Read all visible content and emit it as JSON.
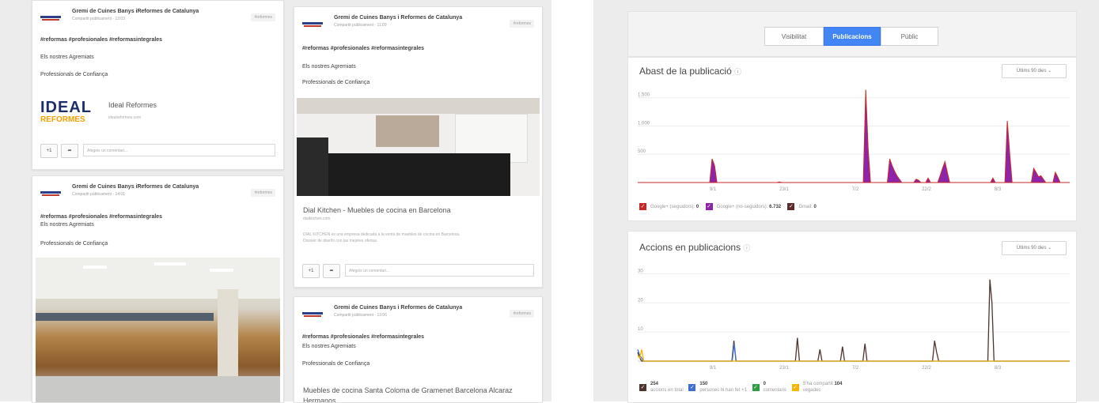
{
  "feed": {
    "author": "Gremi de Cuines Banys i Reformes de Catalunya",
    "author_alt": "Gremi de Cuines Banys iReformes de Catalunya",
    "meta1": "Compartit públicament - 13:03",
    "meta2": "Compartit públicament - 11:09",
    "meta3": "Compartit públicament - 14:01",
    "meta4": "Compartit públicament - 13:06",
    "chip": "#reformes",
    "hashtags": "#reformas  #profesionales  #reformasintegrales",
    "hashtags_alt": "#reformas  #profesionales  #reformasintegrales",
    "line1": "Els nostres Agremiats",
    "line2": "Professionals de Confiança",
    "ideal_logo_top": "IDEAL",
    "ideal_logo_bottom": "REFORMES",
    "ideal_name": "Ideal Reformes",
    "ideal_url": "idealreformes.com",
    "plus": "+1",
    "share": "➦",
    "comment_placeholder": "Afegeix un comentari...",
    "dial_title": "Dial Kitchen - Muebles de cocina en Barcelona",
    "dial_url": "dialkitchen.com",
    "dial_desc1": "DIAL KITCHEN es una empresa dedicada a la venta de muebles de cocina en Barcelona.",
    "dial_desc2": "Dossier de diseño con las mejores ofertas.",
    "santa_title": "Muebles de cocina Santa Coloma de Gramenet Barcelona Alcaraz",
    "santa_title2": "Hermanos"
  },
  "insights": {
    "tabs": [
      "Visibilitat",
      "Publicacions",
      "Públic"
    ],
    "active_tab": 1,
    "reach": {
      "title": "Abast de la publicació",
      "info_icon": "ⓘ",
      "period": "Últims 90 dies",
      "legend": [
        {
          "label": "Google+ (seguidors):",
          "value": "0",
          "color": "#c62828"
        },
        {
          "label": "Google+ (no-seguidors):",
          "value": "6.732",
          "color": "#8e24aa"
        },
        {
          "label": "Gmail:",
          "value": "0",
          "color": "#5d2b2b"
        }
      ]
    },
    "actions": {
      "title": "Accions en publicacions",
      "info_icon": "ⓘ",
      "period": "Últims 90 dies",
      "legend": [
        {
          "value": "254",
          "label": "accions en total",
          "color": "#4e342e"
        },
        {
          "value": "150",
          "label": "persones hi han fet +1",
          "color": "#3f6fd0"
        },
        {
          "value": "0",
          "label": "comentaris",
          "color": "#2e9e44"
        },
        {
          "value": "104",
          "label_pre": "S'ha compartit",
          "label_post": "vegades",
          "color": "#f5b400"
        }
      ]
    }
  },
  "chart_data": [
    {
      "type": "area",
      "title": "Abast de la publicació",
      "x_ticks": [
        "9/1",
        "23/1",
        "7/2",
        "22/2",
        "8/3"
      ],
      "y_ticks": [
        "500",
        "1.000",
        "1.500"
      ],
      "ylim": [
        0,
        1650
      ],
      "series": [
        {
          "name": "Google+ (no-seguidors)",
          "color": "#8e24aa",
          "values": [
            0,
            0,
            0,
            0,
            0,
            0,
            0,
            0,
            0,
            0,
            0,
            0,
            0,
            0,
            0,
            0,
            0,
            0,
            0,
            0,
            0,
            0,
            0,
            0,
            0,
            0,
            0,
            0,
            0,
            0,
            0,
            420,
            300,
            0,
            0,
            0,
            0,
            0,
            0,
            0,
            0,
            0,
            0,
            0,
            0,
            0,
            0,
            0,
            0,
            0,
            0,
            0,
            0,
            0,
            0,
            0,
            0,
            0,
            0,
            10,
            0,
            0,
            0,
            0,
            0,
            0,
            0,
            0,
            0,
            0,
            0,
            0,
            0,
            0,
            0,
            0,
            0,
            0,
            0,
            0,
            0,
            0,
            0,
            0,
            0,
            0,
            0,
            0,
            0,
            0,
            0,
            0,
            0,
            0,
            0,
            1640,
            600,
            0,
            0,
            0,
            0,
            0,
            0,
            0,
            0,
            420,
            300,
            200,
            120,
            60,
            0,
            0,
            0,
            0,
            0,
            0,
            60,
            40,
            0,
            0,
            0,
            80,
            0,
            0,
            0,
            0,
            120,
            250,
            370,
            180,
            0,
            0,
            0,
            0,
            0,
            0,
            0,
            0,
            0,
            0,
            0,
            0,
            0,
            0,
            0,
            0,
            0,
            0,
            80,
            0,
            0,
            0,
            0,
            0,
            1090,
            500,
            0,
            0,
            0,
            0,
            0,
            0,
            0,
            0,
            0,
            250,
            180,
            100,
            120,
            60,
            0,
            0,
            0,
            0,
            180,
            100,
            0,
            0,
            0,
            0,
            0
          ]
        }
      ]
    },
    {
      "type": "line",
      "title": "Accions en publicacions",
      "x_ticks": [
        "9/1",
        "23/1",
        "7/2",
        "22/2",
        "8/3"
      ],
      "y_ticks": [
        "10",
        "20",
        "30"
      ],
      "ylim": [
        0,
        32
      ],
      "series": [
        {
          "name": "accions en total",
          "color": "#4e342e",
          "values": [
            3,
            1,
            0,
            0,
            0,
            0,
            0,
            0,
            0,
            0,
            0,
            0,
            0,
            0,
            0,
            0,
            0,
            0,
            0,
            0,
            0,
            0,
            0,
            0,
            0,
            0,
            0,
            0,
            0,
            0,
            0,
            0,
            0,
            0,
            0,
            0,
            0,
            0,
            0,
            0,
            0,
            0,
            0,
            0,
            0,
            0,
            0,
            7,
            0,
            0,
            0,
            0,
            0,
            0,
            0,
            0,
            0,
            0,
            0,
            0,
            0,
            0,
            0,
            0,
            0,
            0,
            0,
            0,
            0,
            0,
            0,
            0,
            0,
            0,
            0,
            0,
            0,
            0,
            8,
            0,
            0,
            0,
            0,
            0,
            0,
            0,
            0,
            0,
            0,
            4,
            0,
            0,
            0,
            0,
            0,
            0,
            0,
            0,
            0,
            0,
            5,
            0,
            0,
            0,
            0,
            0,
            0,
            0,
            0,
            0,
            0,
            6,
            0,
            0,
            0,
            0,
            0,
            0,
            0,
            0,
            0,
            0,
            0,
            0,
            0,
            0,
            0,
            0,
            0,
            0,
            0,
            0,
            0,
            0,
            0,
            0,
            0,
            0,
            0,
            0,
            0,
            0,
            0,
            0,
            0,
            7,
            3,
            0,
            0,
            0,
            0,
            0,
            0,
            0,
            0,
            0,
            0,
            0,
            0,
            0,
            0,
            0,
            0,
            0,
            0,
            0,
            0,
            0,
            0,
            0,
            0,
            0,
            28,
            20,
            0,
            0,
            0,
            0,
            0,
            0,
            0,
            0,
            0,
            0,
            0,
            0,
            0,
            0,
            0,
            0,
            0,
            0,
            0,
            0,
            0,
            0,
            0,
            0,
            0,
            0,
            0,
            0,
            0,
            0,
            0,
            0,
            0,
            0,
            0,
            0,
            0,
            0
          ]
        },
        {
          "name": "persones hi han fet +1",
          "color": "#3f6fd0",
          "values": [
            4,
            2,
            1,
            0,
            0,
            0,
            0,
            0,
            0,
            0,
            0,
            0,
            0,
            0,
            0,
            0,
            0,
            0,
            0,
            0,
            0,
            0,
            0,
            0,
            0,
            0,
            0,
            0,
            0,
            0,
            0,
            0,
            0,
            0,
            0,
            0,
            0,
            0,
            0,
            0,
            0,
            0,
            0,
            0,
            0,
            0,
            0,
            0,
            6,
            0,
            0,
            0,
            0,
            0,
            0,
            0,
            0,
            0,
            0,
            0,
            0,
            0,
            0,
            0,
            0,
            0,
            0,
            0,
            0,
            0,
            0,
            0,
            0,
            0,
            0,
            0,
            0,
            0,
            0,
            0,
            0,
            0,
            0,
            0,
            0,
            0,
            0,
            0,
            0,
            0,
            0,
            0,
            0,
            0,
            0,
            0,
            0,
            0,
            0,
            0,
            0,
            0,
            0,
            0,
            0,
            0,
            0,
            0,
            0,
            0,
            0,
            0,
            0,
            0,
            0,
            0,
            0,
            0,
            0,
            0,
            0,
            0,
            0,
            0,
            0,
            0,
            0,
            0,
            0,
            0,
            0,
            0,
            0,
            0,
            0,
            0,
            0,
            0,
            0,
            0,
            0,
            0,
            0,
            0,
            0,
            0,
            0,
            0,
            0,
            0,
            0,
            0,
            0,
            0,
            0,
            0,
            0,
            0,
            0,
            0,
            0,
            0,
            0,
            0,
            0,
            0,
            0,
            0,
            0,
            0,
            0,
            0,
            0,
            0,
            0,
            0,
            0,
            0,
            0,
            0,
            0,
            0,
            0,
            0,
            0,
            0,
            0,
            0,
            0,
            0,
            0,
            0,
            0,
            0,
            0,
            0,
            0,
            0,
            0,
            0,
            0,
            0,
            0,
            0,
            0,
            0,
            0,
            0,
            0,
            0,
            0,
            0,
            0,
            0,
            0,
            0
          ]
        },
        {
          "name": "S'ha compartit 104 vegades",
          "color": "#f5b400",
          "values": [
            2,
            1,
            4,
            0,
            0,
            0,
            0,
            0,
            0,
            0,
            0,
            0,
            0,
            0,
            0,
            0,
            0,
            0,
            0,
            0,
            0,
            0,
            0,
            0,
            0,
            0,
            0,
            0,
            0,
            0,
            0,
            0,
            0,
            0,
            0,
            0,
            0,
            0,
            0,
            0,
            0,
            0,
            0,
            0,
            0,
            0,
            0,
            0,
            0,
            0,
            0,
            0,
            0,
            0,
            0,
            0,
            0,
            0,
            0,
            0,
            0,
            0,
            0,
            0,
            0,
            0,
            0,
            0,
            0,
            0,
            0,
            0,
            0,
            0,
            0,
            0,
            0,
            0,
            0,
            0,
            0,
            0,
            0,
            0,
            0,
            0,
            0,
            0,
            0,
            0,
            0,
            0,
            0,
            0,
            0,
            0,
            0,
            0,
            0,
            0,
            0,
            0,
            0,
            0,
            0,
            0,
            0,
            0,
            0,
            0,
            0,
            0,
            0,
            0,
            0,
            0,
            0,
            0,
            0,
            0,
            0,
            0,
            0,
            0,
            0,
            0,
            0,
            0,
            0,
            0,
            0,
            0,
            0,
            0,
            0,
            0,
            0,
            0,
            0,
            0,
            0,
            0,
            0,
            0,
            0,
            0,
            0,
            0,
            0,
            0,
            0,
            0,
            0,
            0,
            0,
            0,
            0,
            0,
            0,
            0,
            0,
            0,
            0,
            0,
            0,
            0,
            0,
            0,
            0,
            0,
            0,
            0,
            0,
            0,
            0,
            0,
            0,
            0,
            0,
            0,
            0,
            0,
            0,
            0,
            0,
            0,
            0,
            0,
            0,
            0,
            0,
            0,
            0,
            0,
            0,
            0,
            0,
            0,
            0,
            0,
            0,
            0,
            0,
            0,
            0,
            0,
            0,
            0,
            0,
            0,
            0,
            0,
            0,
            0,
            0,
            0,
            0,
            0,
            0,
            0
          ]
        }
      ]
    }
  ]
}
